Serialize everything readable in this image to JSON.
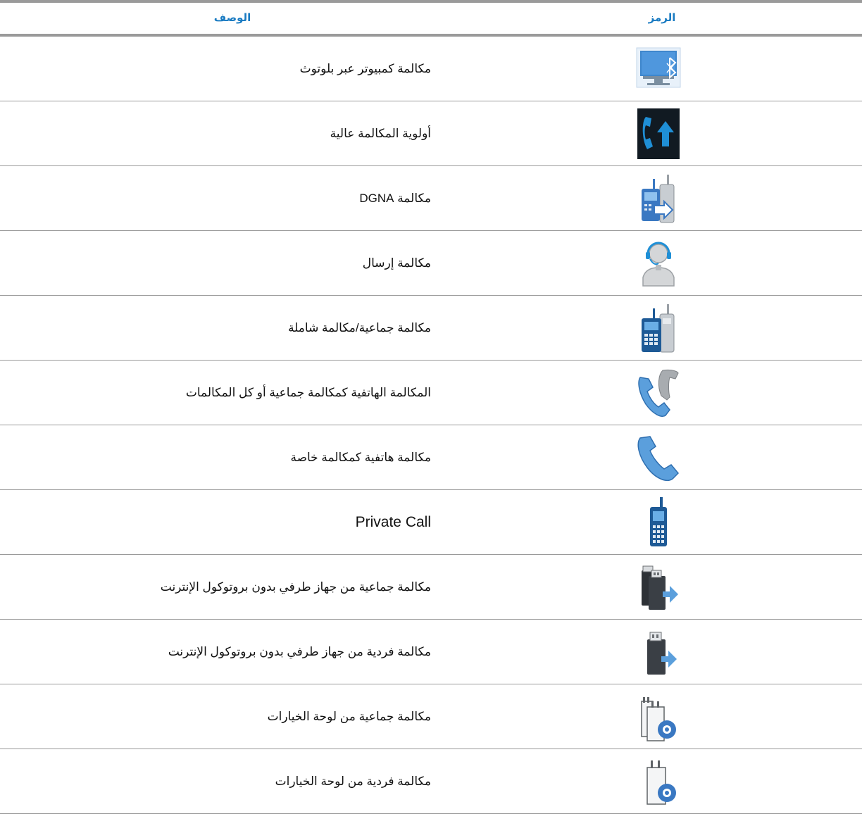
{
  "header": {
    "description_label": "الوصف",
    "icon_label": "الرمز"
  },
  "rows": [
    {
      "icon": "computer-bluetooth-icon",
      "description": "مكالمة كمبيوتر عبر بلوتوث"
    },
    {
      "icon": "high-priority-call-icon",
      "description": "أولوية المكالمة عالية"
    },
    {
      "icon": "dgna-call-icon",
      "description": "مكالمة DGNA"
    },
    {
      "icon": "dispatch-call-icon",
      "description": "مكالمة إرسال"
    },
    {
      "icon": "group-call-icon",
      "description": "مكالمة جماعية/مكالمة شاملة"
    },
    {
      "icon": "phone-group-call-icon",
      "description": "المكالمة الهاتفية كمكالمة جماعية أو كل المكالمات"
    },
    {
      "icon": "phone-private-call-icon",
      "description": "مكالمة هاتفية كمكالمة خاصة"
    },
    {
      "icon": "private-call-icon",
      "description": "Private Call"
    },
    {
      "icon": "non-ip-group-call-icon",
      "description": "مكالمة جماعية من جهاز طرفي بدون بروتوكول الإنترنت"
    },
    {
      "icon": "non-ip-private-call-icon",
      "description": "مكالمة فردية من جهاز طرفي بدون بروتوكول الإنترنت"
    },
    {
      "icon": "option-board-group-call-icon",
      "description": "مكالمة جماعية من لوحة الخيارات"
    },
    {
      "icon": "option-board-private-call-icon",
      "description": "مكالمة فردية من لوحة الخيارات"
    }
  ],
  "colors": {
    "header_text": "#1a7bc2",
    "rule": "#9a9a9a",
    "icon_blue": "#3a78c2",
    "icon_light_blue": "#5b9fdc"
  }
}
